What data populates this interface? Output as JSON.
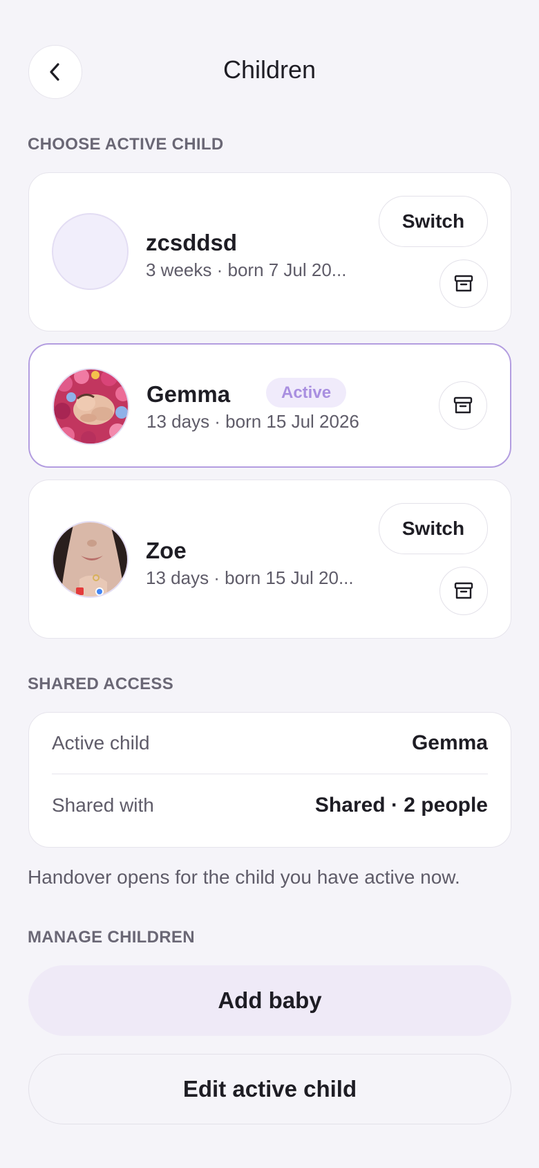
{
  "header": {
    "title": "Children",
    "back_icon": "chevron-left-icon"
  },
  "sections": {
    "choose": "CHOOSE ACTIVE CHILD",
    "shared": "SHARED ACCESS",
    "manage": "MANAGE CHILDREN"
  },
  "children": [
    {
      "name": "zcsddsd",
      "meta": "3 weeks · born 7 Jul 20...",
      "switch_label": "Switch",
      "active": false,
      "avatar": "empty"
    },
    {
      "name": "Gemma",
      "meta": "13 days · born 15 Jul 2026",
      "badge": "Active",
      "active": true,
      "avatar": "newborn-photo"
    },
    {
      "name": "Zoe",
      "meta": "13 days · born 15 Jul 20...",
      "switch_label": "Switch",
      "active": false,
      "avatar": "face-photo"
    }
  ],
  "shared_access": {
    "active_child_label": "Active child",
    "active_child_value": "Gemma",
    "shared_with_label": "Shared with",
    "shared_with_value": "Shared · 2 people"
  },
  "note": "Handover opens for the child you have active now.",
  "actions": {
    "add_baby": "Add baby",
    "edit_active_child": "Edit active child"
  },
  "colors": {
    "background": "#f5f4f9",
    "accent_border": "#b39de0",
    "badge_bg": "#f0ebfb",
    "badge_text": "#a98fe0",
    "primary_button_bg": "#efeaf7"
  }
}
